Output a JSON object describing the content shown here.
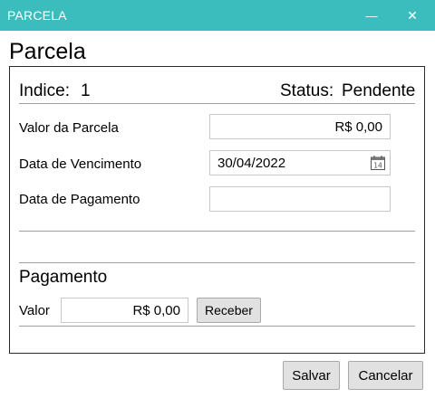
{
  "window": {
    "title": "PARCELA",
    "minimize_glyph": "—",
    "close_glyph": "✕"
  },
  "heading": "Parcela",
  "header": {
    "indice_label": "Indice:",
    "indice_value": "1",
    "status_label": "Status:",
    "status_value": "Pendente"
  },
  "fields": {
    "valor_parcela_label": "Valor da Parcela",
    "valor_parcela_value": "R$ 0,00",
    "data_vencimento_label": "Data de Vencimento",
    "data_vencimento_value": "30/04/2022",
    "data_pagamento_label": "Data de Pagamento",
    "data_pagamento_value": ""
  },
  "pagamento": {
    "section_title": "Pagamento",
    "valor_label": "Valor",
    "valor_value": "R$ 0,00",
    "receber_button": "Receber"
  },
  "footer": {
    "save_button": "Salvar",
    "cancel_button": "Cancelar"
  },
  "icons": {
    "calendar": "calendar-icon",
    "minimize": "minimize-icon",
    "close": "close-icon"
  },
  "colors": {
    "titlebar": "#3bbdbd",
    "button_bg": "#e1e1e1"
  }
}
